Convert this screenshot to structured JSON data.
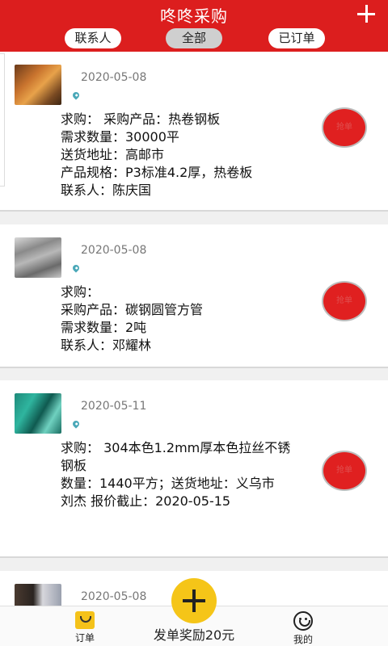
{
  "header": {
    "title": "咚咚采购",
    "add_icon": "plus-icon",
    "tabs": [
      {
        "label": "联系人",
        "active": false
      },
      {
        "label": "全部",
        "active": true
      },
      {
        "label": "已订单",
        "active": false
      }
    ]
  },
  "orders": [
    {
      "date": "2020-05-08",
      "lines": [
        "求购： 采购产品：热卷钢板",
        "需求数量：30000平",
        "送货地址：高邮市",
        "产品规格：P3标准4.2厚，热卷板",
        "联系人：陈庆国"
      ],
      "action_label": "抢单"
    },
    {
      "date": "2020-05-08",
      "lines": [
        "求购：",
        "采购产品：碳钢圆管方管",
        "需求数量：2吨",
        "联系人：邓耀林"
      ],
      "action_label": "抢单"
    },
    {
      "date": "2020-05-11",
      "lines": [
        "求购： 304本色1.2mm厚本色拉丝不锈钢板",
        "数量：1440平方；送货地址：义乌市",
        "刘杰 报价截止：2020-05-15"
      ],
      "action_label": "抢单"
    },
    {
      "date": "2020-05-08",
      "lines": [],
      "action_label": ""
    }
  ],
  "bottom_nav": {
    "orders_label": "订单",
    "center_label": "发单奖励20元",
    "me_label": "我的"
  },
  "colors": {
    "header": "#dc1e1e",
    "accent_yellow": "#f5c518",
    "action_red": "#e02020"
  }
}
